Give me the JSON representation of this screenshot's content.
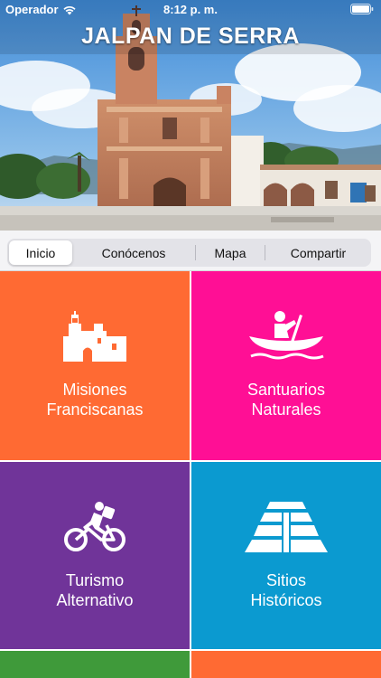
{
  "status_bar": {
    "carrier": "Operador",
    "time": "8:12 p. m.",
    "wifi_icon": "wifi-icon",
    "battery_icon": "battery-icon"
  },
  "hero": {
    "title": "JALPAN DE SERRA",
    "image": "church-photo"
  },
  "segmented_control": {
    "items": [
      "Inicio",
      "Conócenos",
      "Mapa",
      "Compartir"
    ],
    "selected": "Inicio"
  },
  "tiles": [
    {
      "line1": "Misiones",
      "line2": "Franciscanas",
      "icon": "mission-church-icon",
      "color": "#ff6a33"
    },
    {
      "line1": "Santuarios",
      "line2": "Naturales",
      "icon": "canoe-icon",
      "color": "#ff0f95"
    },
    {
      "line1": "Turismo",
      "line2": "Alternativo",
      "icon": "cyclist-icon",
      "color": "#703499"
    },
    {
      "line1": "Sitios",
      "line2": "Históricos",
      "icon": "pyramid-icon",
      "color": "#0b9ad0"
    }
  ],
  "partial_tiles_colors": [
    "#3f9a3a",
    "#ff6a33"
  ]
}
